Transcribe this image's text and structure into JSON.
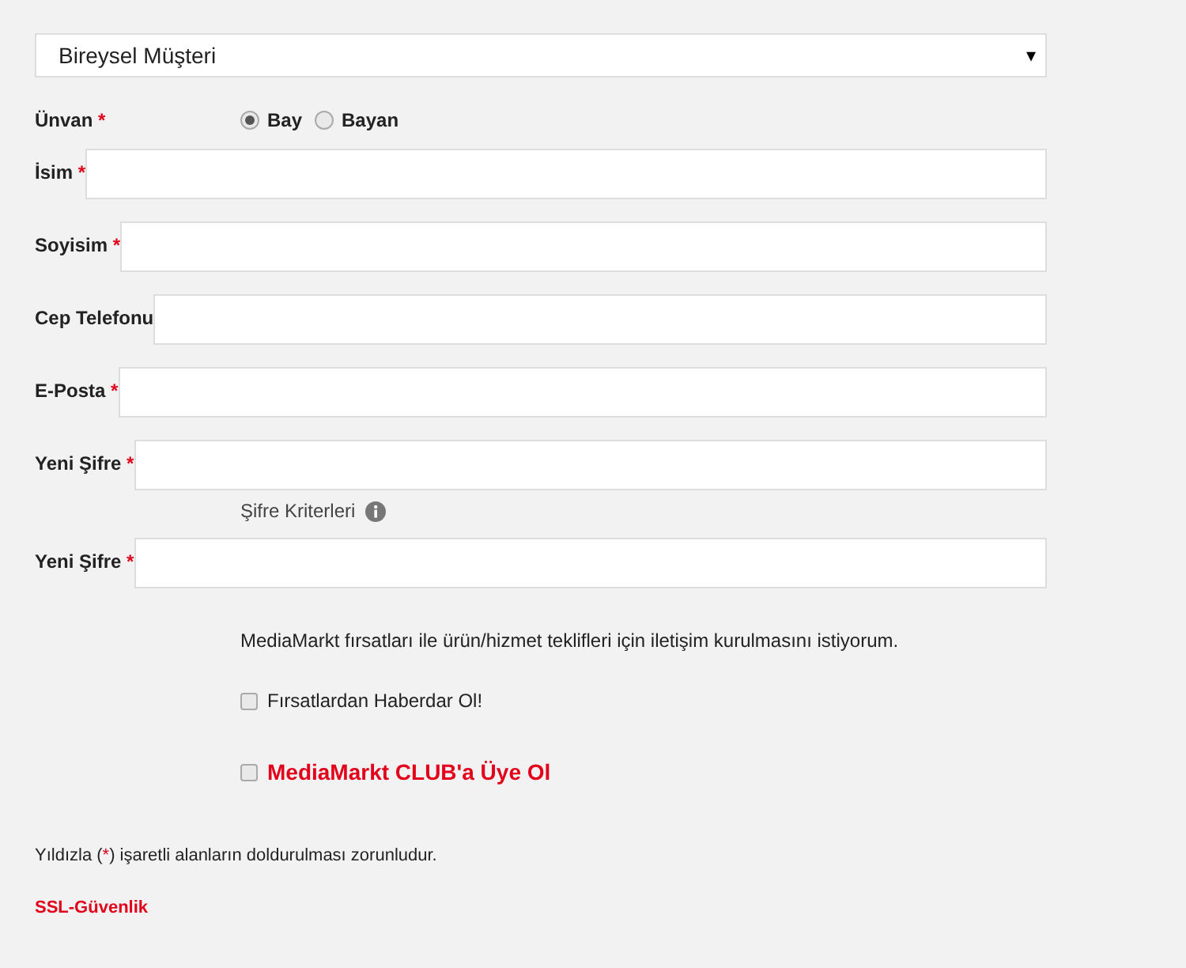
{
  "customer_type": {
    "value": "Bireysel Müşteri",
    "caret": "▾"
  },
  "title_field": {
    "label": "Ünvan",
    "mark": "*",
    "options": [
      {
        "label": "Bay",
        "selected": true
      },
      {
        "label": "Bayan",
        "selected": false
      }
    ]
  },
  "fields": [
    {
      "label": "İsim",
      "mark": "*"
    },
    {
      "label": "Soyisim",
      "mark": "*"
    },
    {
      "label": "Cep Telefonu"
    },
    {
      "label": "E-Posta",
      "mark": "*"
    },
    {
      "label": "Yeni Şifre",
      "mark": "*",
      "hint": "Şifre Kriterleri"
    },
    {
      "label": "Yeni Şifre",
      "mark": "*"
    }
  ],
  "consent_text": "MediaMarkt fırsatları ile ürün/hizmet teklifleri için iletişim kurulmasını istiyorum.",
  "checkboxes": [
    {
      "kind": "plain",
      "label": "Fırsatlardan Haberdar Ol!",
      "checked": false
    },
    {
      "kind": "club",
      "label": "MediaMarkt CLUB'a Üye Ol",
      "checked": false
    }
  ],
  "footnote": {
    "before": "Yıldızla (",
    "mark": "*",
    "after": ") işaretli alanların doldurulması zorunludur."
  },
  "ssl_link": "SSL-Güvenlik"
}
